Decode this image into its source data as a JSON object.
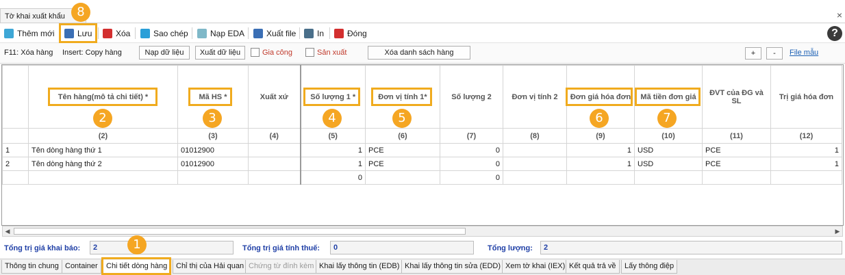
{
  "window": {
    "tab_title": "Tờ khai xuất khẩu",
    "close_icon": "×"
  },
  "toolbar": {
    "add": "Thêm mới",
    "save": "Lưu",
    "delete": "Xóa",
    "copy": "Sao chép",
    "load_eda": "Nạp EDA",
    "export_file": "Xuất file",
    "print": "In",
    "close": "Đóng",
    "help": "?"
  },
  "subbar": {
    "f11": "F11: Xóa hàng",
    "insert": "Insert: Copy hàng",
    "load_data": "Nạp dữ liệu",
    "export_data": "Xuất dữ liệu",
    "gia_cong": "Gia công",
    "san_xuat": "Sản xuất",
    "clear_list": "Xóa danh sách hàng",
    "plus": "+",
    "minus": "-",
    "file_mau": "File mẫu"
  },
  "grid": {
    "headers": [
      "",
      "Tên hàng(mô tả chi tiết) *",
      "Mã HS *",
      "Xuất xứ",
      "Số lượng 1 *",
      "Đơn vị tính 1*",
      "Số lượng 2",
      "Đơn vị tính 2",
      "Đơn giá hóa đơn",
      "Mã tiền đơn giá",
      "ĐVT của ĐG và SL",
      "Trị giá hóa đơn"
    ],
    "numbers": [
      "",
      "(2)",
      "(3)",
      "(4)",
      "(5)",
      "(6)",
      "(7)",
      "(8)",
      "(9)",
      "(10)",
      "(11)",
      "(12)"
    ],
    "rows": [
      [
        "1",
        "Tên dòng hàng thứ 1",
        "01012900",
        "",
        "1",
        "PCE",
        "0",
        "",
        "1",
        "USD",
        "PCE",
        "1"
      ],
      [
        "2",
        "Tên dòng hàng thứ 2",
        "01012900",
        "",
        "1",
        "PCE",
        "0",
        "",
        "1",
        "USD",
        "PCE",
        "1"
      ],
      [
        "",
        "",
        "",
        "",
        "0",
        "",
        "0",
        "",
        "",
        "",
        "",
        ""
      ]
    ]
  },
  "totals": {
    "khai_bao_label": "Tổng trị giá khai báo:",
    "khai_bao_value": "2",
    "tinh_thue_label": "Tổng trị giá tính thuế:",
    "tinh_thue_value": "0",
    "luong_label": "Tổng lượng:",
    "luong_value": "2"
  },
  "bottom_tabs": [
    "Thông tin chung",
    "Container",
    "Chi tiết dòng hàng",
    "Chỉ thị của Hải quan",
    "Chứng từ đính kèm",
    "Khai lấy thông tin (EDB)",
    "Khai lấy thông tin sửa (EDD)",
    "Xem tờ khai (IEX)",
    "Kết quả trả về",
    "Lấy thông điệp"
  ],
  "callouts": [
    "1",
    "2",
    "3",
    "4",
    "5",
    "6",
    "7",
    "8"
  ],
  "colors": {
    "accent": "#f5a623",
    "totals_text": "#1f3fa6",
    "red_text": "#c0392b"
  }
}
